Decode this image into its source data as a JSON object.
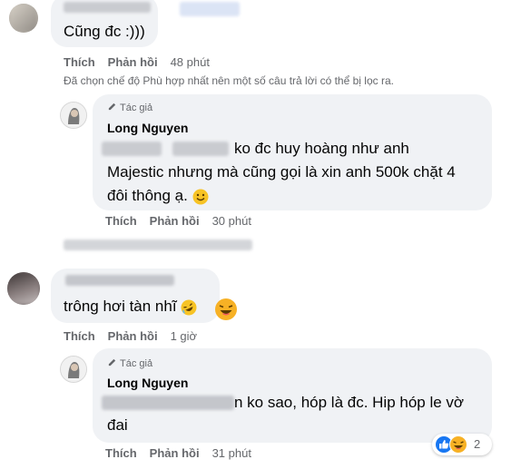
{
  "comments": [
    {
      "text": "Cũng đc :)))",
      "actions": {
        "like": "Thích",
        "reply": "Phản hồi",
        "time": "48 phút"
      }
    },
    {
      "text": "trông hơi tàn nhĩ",
      "actions": {
        "like": "Thích",
        "reply": "Phản hồi",
        "time": "1 giờ"
      }
    }
  ],
  "filter_notice": "Đã chọn chế độ Phù hợp nhất nên một số câu trả lời có thể bị lọc ra.",
  "replies": [
    {
      "badge": "Tác giả",
      "author": "Long Nguyen",
      "line1": "ko đc huy hoàng như anh",
      "line2": "Majestic nhưng mà cũng gọi là xin anh 500k chặt 4",
      "line3": "đôi thông ạ.",
      "actions": {
        "like": "Thích",
        "reply": "Phản hồi",
        "time": "30 phút"
      }
    },
    {
      "badge": "Tác giả",
      "author": "Long Nguyen",
      "line1": "n ko sao, hóp là đc. Hip hóp le vờ",
      "line2": "đai",
      "actions": {
        "like": "Thích",
        "reply": "Phản hồi",
        "time": "31 phút"
      },
      "reactions": {
        "count": "2",
        "types": [
          "like-icon",
          "haha-icon"
        ]
      }
    }
  ],
  "colors": {
    "bubble": "#f0f2f5",
    "meta_text": "#65676b",
    "like_blue": "#1877f2",
    "haha_yellow": "#f7b125"
  }
}
